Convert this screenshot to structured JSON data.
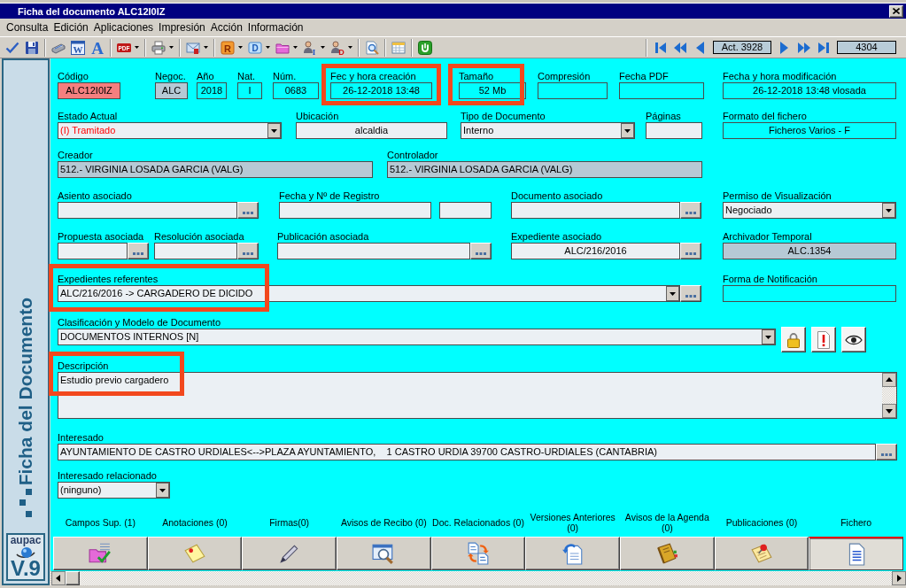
{
  "window": {
    "title": "Ficha del documento ALC12I0IZ"
  },
  "menu": [
    "Consulta",
    "Edición",
    "Aplicaciones",
    "Impresión",
    "Acción",
    "Información"
  ],
  "toolbar": {
    "groups": [
      {
        "buttons": [
          {
            "dropdown": false
          },
          {
            "dropdown": false
          }
        ]
      },
      {
        "buttons": [
          {
            "dropdown": false
          },
          {
            "dropdown": false,
            "glyph": "W"
          },
          {
            "dropdown": false,
            "glyph": "A"
          }
        ]
      },
      {
        "buttons": [
          {
            "dropdown": true,
            "glyph": "PDF"
          }
        ]
      },
      {
        "buttons": [
          {
            "dropdown": true
          }
        ]
      },
      {
        "buttons": [
          {
            "dropdown": true
          }
        ]
      },
      {
        "buttons": [
          {
            "dropdown": true,
            "glyph": "R"
          },
          {
            "dropdown": true,
            "glyph": "D"
          },
          {
            "dropdown": true
          },
          {
            "dropdown": true,
            "glyph": "I"
          },
          {
            "dropdown": true,
            "glyph": "D"
          }
        ]
      },
      {
        "buttons": [
          {
            "dropdown": false
          }
        ]
      },
      {
        "buttons": [
          {
            "dropdown": false
          }
        ]
      },
      {
        "buttons": [
          {
            "dropdown": false
          }
        ]
      }
    ]
  },
  "record_nav": {
    "current": "Act. 3928",
    "total": "4304"
  },
  "sidebar": {
    "title": "Ficha del Documento",
    "logo": "aupac",
    "version": "V.9"
  },
  "form": {
    "rows": [
      {
        "fields": [
          {
            "label": "Código",
            "value": "ALC12I0IZ",
            "kind": "text",
            "color": "#f47f7f",
            "warning": false,
            "highlighted": false
          },
          {
            "label": "Negoc.",
            "value": "ALC",
            "kind": "text",
            "color": "#b6c9d5",
            "warning": false,
            "highlighted": false
          },
          {
            "label": "Año",
            "value": "2018",
            "kind": "text",
            "color": "#00ffff",
            "warning": false,
            "highlighted": false
          },
          {
            "label": "Nat.",
            "value": "I",
            "kind": "text",
            "color": "#00ffff",
            "warning": false,
            "highlighted": false
          },
          {
            "label": "Núm.",
            "value": "0683",
            "kind": "text",
            "color": "#00ffff",
            "warning": false,
            "highlighted": false
          },
          {
            "label": "Fec y hora creación",
            "value": "26-12-2018 13:48",
            "kind": "text",
            "color": "#00ffff",
            "warning": false,
            "highlighted": true
          },
          {
            "label": "Tamaño",
            "value": "52 Mb",
            "kind": "text",
            "color": "#00ffff",
            "warning": false,
            "highlighted": true
          },
          {
            "label": "Compresión",
            "kind": "text",
            "color": "#00ffff",
            "highlighted": false
          },
          {
            "label": "Fecha PDF",
            "kind": "text",
            "color": "#00ffff",
            "highlighted": false
          },
          {
            "label": "Fecha y hora modificación",
            "value": "26-12-2018 13:48 vlosada",
            "kind": "text",
            "color": "#00ffff",
            "warning": false,
            "highlighted": false
          }
        ]
      },
      {
        "fields": [
          {
            "label": "Estado Actual",
            "value": "(I) Tramitado",
            "kind": "combo",
            "color": "#ebf0f4",
            "warning": true,
            "highlighted": false
          },
          {
            "label": "Ubicación",
            "value": "alcaldia",
            "kind": "text",
            "color": "#ebf0f4",
            "warning": false,
            "highlighted": false
          },
          {
            "label": "Tipo de Documento",
            "value": "Interno",
            "kind": "combo",
            "color": "#ebf0f4",
            "warning": false,
            "highlighted": false
          },
          {
            "label": "Páginas",
            "kind": "text",
            "color": "#ebf0f4",
            "highlighted": false
          },
          {
            "label": "Formato del fichero",
            "value": "Ficheros Varios - F",
            "kind": "text",
            "color": "#00ffff",
            "warning": false,
            "highlighted": false
          }
        ]
      },
      {
        "fields": [
          {
            "label": "Creador",
            "value": "512.- VIRGINIA LOSADA GARCIA (VALG)",
            "kind": "text",
            "color": "#b6c9d5",
            "warning": false,
            "highlighted": false
          },
          {
            "label": "Controlador",
            "value": "512.- VIRGINIA LOSADA GARCIA (VALG)",
            "kind": "text",
            "color": "#b6c9d5",
            "warning": false,
            "highlighted": false
          }
        ]
      },
      {
        "fields": [
          {
            "label": "Asiento asociado",
            "kind": "lookup",
            "color": "#ebf0f4",
            "highlighted": false
          },
          {
            "label": "Fecha y Nº de Registro",
            "kind": "split",
            "color": "#ebf0f4",
            "highlighted": false
          },
          {
            "label": "Documento asociado",
            "kind": "lookup",
            "color": "#ebf0f4",
            "highlighted": false
          },
          {
            "label": "Permiso de Visualización",
            "value": "Negociado",
            "kind": "combo",
            "color": "#ebf0f4",
            "warning": false,
            "highlighted": false
          }
        ]
      },
      {
        "fields": [
          {
            "label": "Propuesta asociada",
            "kind": "lookup",
            "color": "#ebf0f4",
            "highlighted": false
          },
          {
            "label": "Resolución asociada",
            "kind": "lookup",
            "color": "#ebf0f4",
            "highlighted": false
          },
          {
            "label": "Publicación asociada",
            "kind": "lookup",
            "color": "#ebf0f4",
            "highlighted": false
          },
          {
            "label": "Expediente asociado",
            "value": "ALC/216/2016",
            "kind": "lookup",
            "color": "#ebf0f4",
            "warning": false,
            "highlighted": false
          },
          {
            "label": "Archivador Temporal",
            "value": "ALC.1354",
            "kind": "text",
            "color": "#b6c9d5",
            "warning": false,
            "highlighted": false
          }
        ]
      },
      {
        "fields": [
          {
            "label": "Expedientes referentes",
            "value": "ALC/216/2016 -> CARGADERO DE DICIDO",
            "kind": "combo-lookup",
            "color": "#ebf0f4",
            "warning": false,
            "highlighted": true
          },
          {
            "label": "Forma de Notificación",
            "kind": "text",
            "color": "#00ffff",
            "highlighted": false
          }
        ]
      },
      {
        "fields": [
          {
            "label": "Clasificación y Modelo de Documento",
            "value": "DOCUMENTOS INTERNOS [N]",
            "kind": "combo",
            "color": "#ebf0f4",
            "warning": false,
            "highlighted": false
          }
        ]
      },
      {
        "fields": [
          {
            "label": "Descripción",
            "value": "Estudio previo cargadero",
            "kind": "memo",
            "color": "#ebf0f4",
            "warning": false,
            "highlighted": true
          }
        ]
      },
      {
        "fields": [
          {
            "label": "Interesado",
            "value": "AYUNTAMIENTO DE CASTRO URDIALES<-->PLAZA AYUNTAMIENTO,    1 CASTRO URDIA 39700 CASTRO-URDIALES (CANTABRIA)",
            "kind": "lookup",
            "color": "#ebf0f4",
            "warning": false,
            "highlighted": false
          }
        ]
      },
      {
        "fields": [
          {
            "label": "Interesado relacionado",
            "value": "(ninguno)",
            "kind": "combo",
            "color": "#ebf0f4",
            "warning": false,
            "highlighted": false
          }
        ]
      }
    ]
  },
  "tabs": [
    {
      "label": "Campos Sup. (1)",
      "selected": false
    },
    {
      "label": "Anotaciones (0)",
      "selected": false
    },
    {
      "label": "Firmas(0)",
      "selected": false
    },
    {
      "label": "Avisos de Recibo (0)",
      "selected": false
    },
    {
      "label": "Doc. Relacionados (0)",
      "selected": false
    },
    {
      "label": "Versiones Anteriores (0)",
      "selected": false
    },
    {
      "label": "Avisos de la Agenda (0)",
      "selected": false
    },
    {
      "label": "Publicaciones (0)",
      "selected": false
    },
    {
      "label": "Fichero",
      "selected": true
    }
  ]
}
